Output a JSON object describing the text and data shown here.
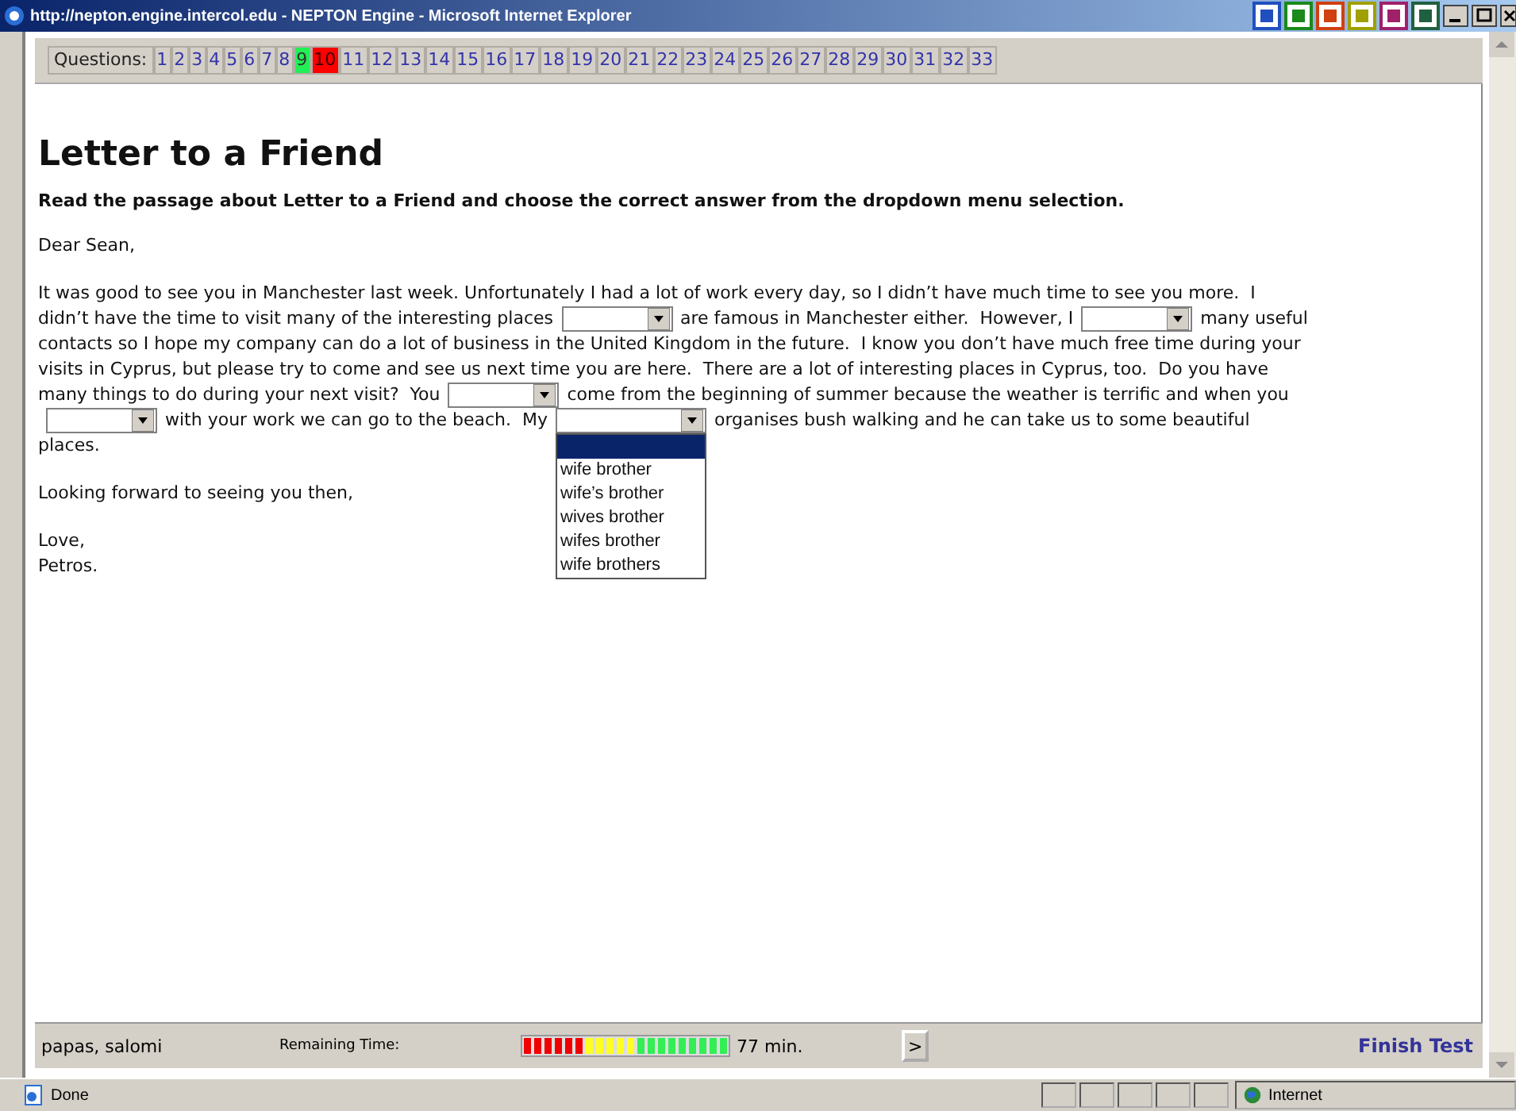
{
  "window": {
    "title": "http://nepton.engine.intercol.edu - NEPTON Engine - Microsoft Internet Explorer"
  },
  "questions": {
    "label": "Questions:",
    "items": [
      {
        "label": "1",
        "answered": false,
        "selected": false
      },
      {
        "label": "2",
        "answered": false,
        "selected": false
      },
      {
        "label": "3",
        "answered": false,
        "selected": false
      },
      {
        "label": "4",
        "answered": false,
        "selected": false
      },
      {
        "label": "5",
        "answered": false,
        "selected": false
      },
      {
        "label": "6",
        "answered": false,
        "selected": false
      },
      {
        "label": "7",
        "answered": false,
        "selected": false
      },
      {
        "label": "8",
        "answered": false,
        "selected": false
      },
      {
        "label": "9",
        "answered": true,
        "selected": false
      },
      {
        "label": "10",
        "answered": false,
        "selected": true
      },
      {
        "label": "11",
        "answered": false,
        "selected": false
      },
      {
        "label": "12",
        "answered": false,
        "selected": false
      },
      {
        "label": "13",
        "answered": false,
        "selected": false
      },
      {
        "label": "14",
        "answered": false,
        "selected": false
      },
      {
        "label": "15",
        "answered": false,
        "selected": false
      },
      {
        "label": "16",
        "answered": false,
        "selected": false
      },
      {
        "label": "17",
        "answered": false,
        "selected": false
      },
      {
        "label": "18",
        "answered": false,
        "selected": false
      },
      {
        "label": "19",
        "answered": false,
        "selected": false
      },
      {
        "label": "20",
        "answered": false,
        "selected": false
      },
      {
        "label": "21",
        "answered": false,
        "selected": false
      },
      {
        "label": "22",
        "answered": false,
        "selected": false
      },
      {
        "label": "23",
        "answered": false,
        "selected": false
      },
      {
        "label": "24",
        "answered": false,
        "selected": false
      },
      {
        "label": "25",
        "answered": false,
        "selected": false
      },
      {
        "label": "26",
        "answered": false,
        "selected": false
      },
      {
        "label": "27",
        "answered": false,
        "selected": false
      },
      {
        "label": "28",
        "answered": false,
        "selected": false
      },
      {
        "label": "29",
        "answered": false,
        "selected": false
      },
      {
        "label": "30",
        "answered": false,
        "selected": false
      },
      {
        "label": "31",
        "answered": false,
        "selected": false
      },
      {
        "label": "32",
        "answered": false,
        "selected": false
      },
      {
        "label": "33",
        "answered": false,
        "selected": false
      }
    ]
  },
  "heading": "Letter to a Friend",
  "instruction": "Read the passage about Letter to a Friend and choose the correct answer from the dropdown menu selection.",
  "paragraphs": [
    [
      {
        "kind": "text",
        "text": "Dear Sean,"
      }
    ],
    [
      {
        "kind": "text",
        "text": "It was good to see you in Manchester last week. Unfortunately I had a lot of work every day, so I didn’t have much time to see you more.  I"
      },
      {
        "kind": "break"
      },
      {
        "kind": "text",
        "text": "didn’t have the time to visit many of the interesting places"
      },
      {
        "kind": "blank",
        "expanded": false
      },
      {
        "kind": "text",
        "text": "are famous in Manchester either.  However, I"
      },
      {
        "kind": "blank",
        "expanded": false
      },
      {
        "kind": "text",
        "text": "many useful"
      },
      {
        "kind": "break"
      },
      {
        "kind": "text",
        "text": "contacts so I hope my company can do a lot of business in the United Kingdom in the future.  I know you don’t have much free time during your"
      },
      {
        "kind": "break"
      },
      {
        "kind": "text",
        "text": "visits in Cyprus, but please try to come and see us next time you are here.  There are a lot of interesting places in Cyprus, too.  Do you have"
      },
      {
        "kind": "break"
      },
      {
        "kind": "text",
        "text": "many things to do during your next visit?  You"
      },
      {
        "kind": "blank",
        "expanded": false
      },
      {
        "kind": "text",
        "text": "come from the beginning of summer because the weather is terrific and when you"
      },
      {
        "kind": "break"
      },
      {
        "kind": "blank",
        "expanded": false
      },
      {
        "kind": "text",
        "text": "with your work we can go to the beach.  My"
      },
      {
        "kind": "blank",
        "expanded": true,
        "options": [
          {
            "label": "wife brother",
            "selected": false
          },
          {
            "label": "wife’s brother",
            "selected": false
          },
          {
            "label": "wives brother",
            "selected": false
          },
          {
            "label": "wifes brother",
            "selected": false
          },
          {
            "label": "wife brothers",
            "selected": false
          }
        ]
      },
      {
        "kind": "text",
        "text": "organises bush walking and he can take us to some beautiful"
      },
      {
        "kind": "break"
      },
      {
        "kind": "text",
        "text": "places."
      }
    ],
    [
      {
        "kind": "text",
        "text": "Looking forward to seeing you then,"
      }
    ],
    [
      {
        "kind": "text",
        "text": "Love,"
      },
      {
        "kind": "break"
      },
      {
        "kind": "text",
        "text": "Petros."
      }
    ]
  ],
  "footer": {
    "user": "papas, salomi",
    "time_label": "Remaining Time:",
    "timer": {
      "level": 1
    },
    "time": "77 min.",
    "next_button": ">",
    "finish": "Finish Test"
  },
  "status_bar": {
    "status": "Done",
    "zone": "Internet"
  }
}
